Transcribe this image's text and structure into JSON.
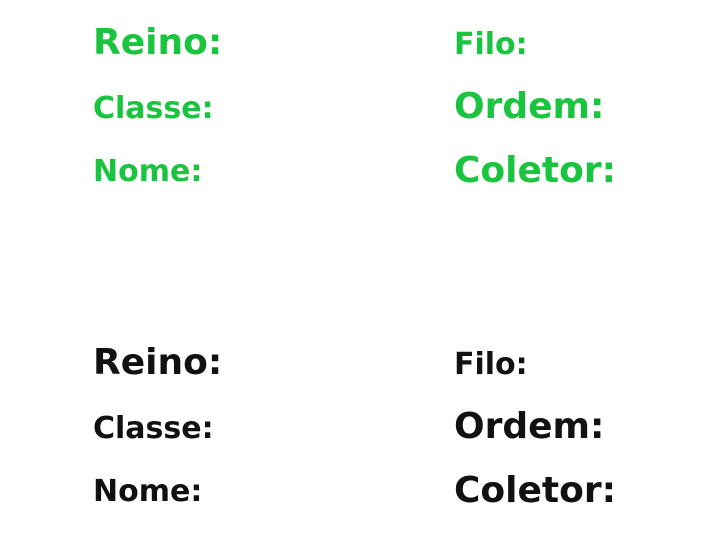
{
  "colors": {
    "green": "#1bc43f",
    "black": "#111111"
  },
  "card_green": {
    "reino": "Reino:",
    "filo": "Filo:",
    "classe": "Classe:",
    "ordem": "Ordem:",
    "nome": "Nome:",
    "coletor": "Coletor:"
  },
  "card_black": {
    "reino": "Reino:",
    "filo": "Filo:",
    "classe": "Classe:",
    "ordem": "Ordem:",
    "nome": "Nome:",
    "coletor": "Coletor:"
  }
}
